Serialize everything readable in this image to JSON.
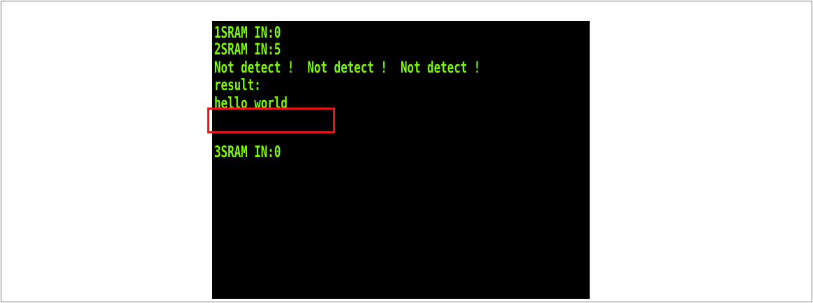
{
  "terminal": {
    "text_color": "#7cfc00",
    "background": "#000000",
    "lines": [
      "1SRAM IN:0",
      "2SRAM IN:5",
      "Not detect !  Not detect !  Not detect !",
      "result:",
      "hello world",
      "3SRAM IN:0"
    ]
  },
  "highlight": {
    "color": "#e01818",
    "target": "hello world"
  }
}
